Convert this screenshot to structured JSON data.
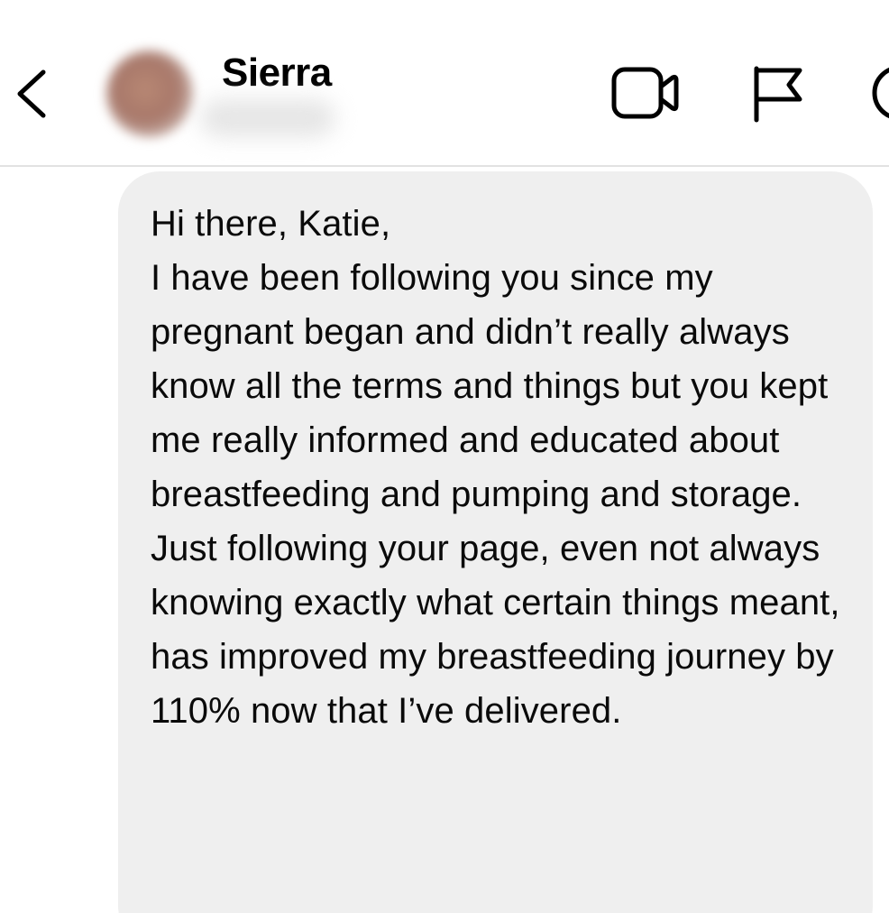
{
  "header": {
    "contact_name": "Sierra",
    "icons": {
      "back": "chevron-left-icon",
      "video": "video-camera-icon",
      "flag": "flag-icon",
      "info": "info-icon"
    }
  },
  "conversation": {
    "messages": [
      {
        "sender": "Sierra",
        "text": "Hi there, Katie,\nI have been following you since my pregnant began and didn’t really always know all the terms and things but you kept me really informed and educated about breastfeeding and pumping and storage. Just following your page, even not always knowing exactly what certain things meant, has improved my breastfeeding journey by 110% now that I’ve delivered."
      }
    ]
  },
  "colors": {
    "bubble_background": "#efefef",
    "divider": "#e2e2e2",
    "text": "#000000"
  }
}
